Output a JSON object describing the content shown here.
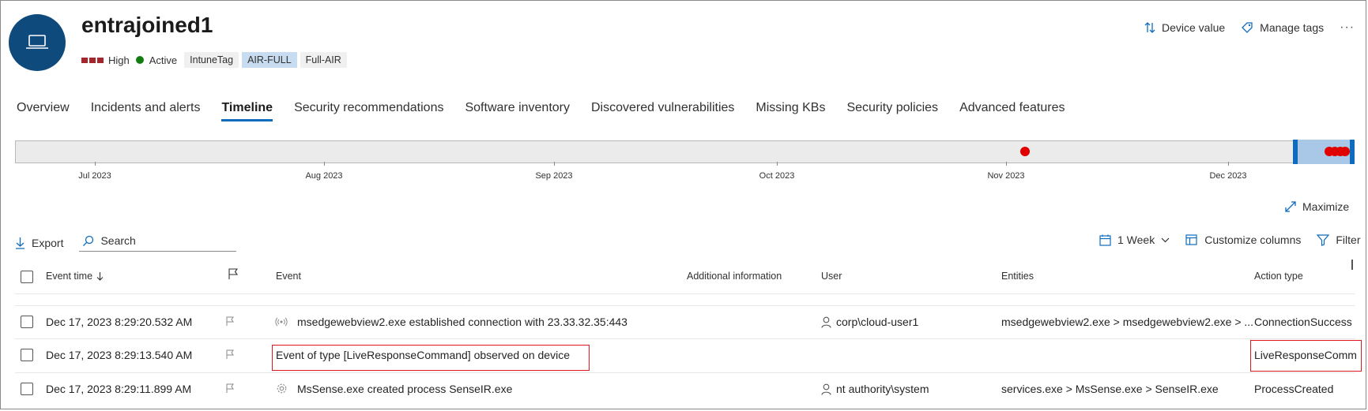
{
  "device": {
    "name": "entrajoined1",
    "risk_level": "High",
    "status": "Active",
    "tags": [
      "IntuneTag",
      "AIR-FULL",
      "Full-AIR"
    ]
  },
  "header_actions": {
    "device_value": "Device value",
    "manage_tags": "Manage tags",
    "more": "···"
  },
  "tabs": [
    {
      "label": "Overview",
      "active": false
    },
    {
      "label": "Incidents and alerts",
      "active": false
    },
    {
      "label": "Timeline",
      "active": true
    },
    {
      "label": "Security recommendations",
      "active": false
    },
    {
      "label": "Software inventory",
      "active": false
    },
    {
      "label": "Discovered vulnerabilities",
      "active": false
    },
    {
      "label": "Missing KBs",
      "active": false
    },
    {
      "label": "Security policies",
      "active": false
    },
    {
      "label": "Advanced features",
      "active": false
    }
  ],
  "timeline": {
    "months": [
      "Jul 2023",
      "Aug 2023",
      "Sep 2023",
      "Oct 2023",
      "Nov 2023",
      "Dec 2023"
    ],
    "maximize_label": "Maximize"
  },
  "toolbar": {
    "export": "Export",
    "search_placeholder": "Search",
    "time_range": "1 Week",
    "customize_columns": "Customize columns",
    "filter": "Filter"
  },
  "table": {
    "headers": {
      "event_time": "Event time",
      "event": "Event",
      "additional_information": "Additional information",
      "user": "User",
      "entities": "Entities",
      "action_type": "Action type"
    },
    "rows": [
      {
        "time": "Dec 17, 2023 8:29:20.532 AM",
        "event_icon": "network-icon",
        "event": "msedgewebview2.exe established connection with 23.33.32.35:443",
        "additional_information": "",
        "user": "corp\\cloud-user1",
        "entities": "msedgewebview2.exe > msedgewebview2.exe > ...",
        "action_type": "ConnectionSuccess"
      },
      {
        "time": "Dec 17, 2023 8:29:13.540 AM",
        "event_icon": "",
        "event": "Event of type [LiveResponseCommand] observed on device",
        "additional_information": "",
        "user": "",
        "entities": "",
        "action_type": "LiveResponseComma"
      },
      {
        "time": "Dec 17, 2023 8:29:11.899 AM",
        "event_icon": "gear-icon",
        "event": "MsSense.exe created process SenseIR.exe",
        "additional_information": "",
        "user": "nt authority\\system",
        "entities": "services.exe > MsSense.exe > SenseIR.exe",
        "action_type": "ProcessCreated"
      }
    ]
  },
  "colors": {
    "accent": "#0f6cbd",
    "avatar_bg": "#0f4a7c",
    "risk_high": "#a4262c",
    "active_green": "#107c10",
    "timeline_dot": "#e00000",
    "highlight_box": "#e0161e"
  }
}
